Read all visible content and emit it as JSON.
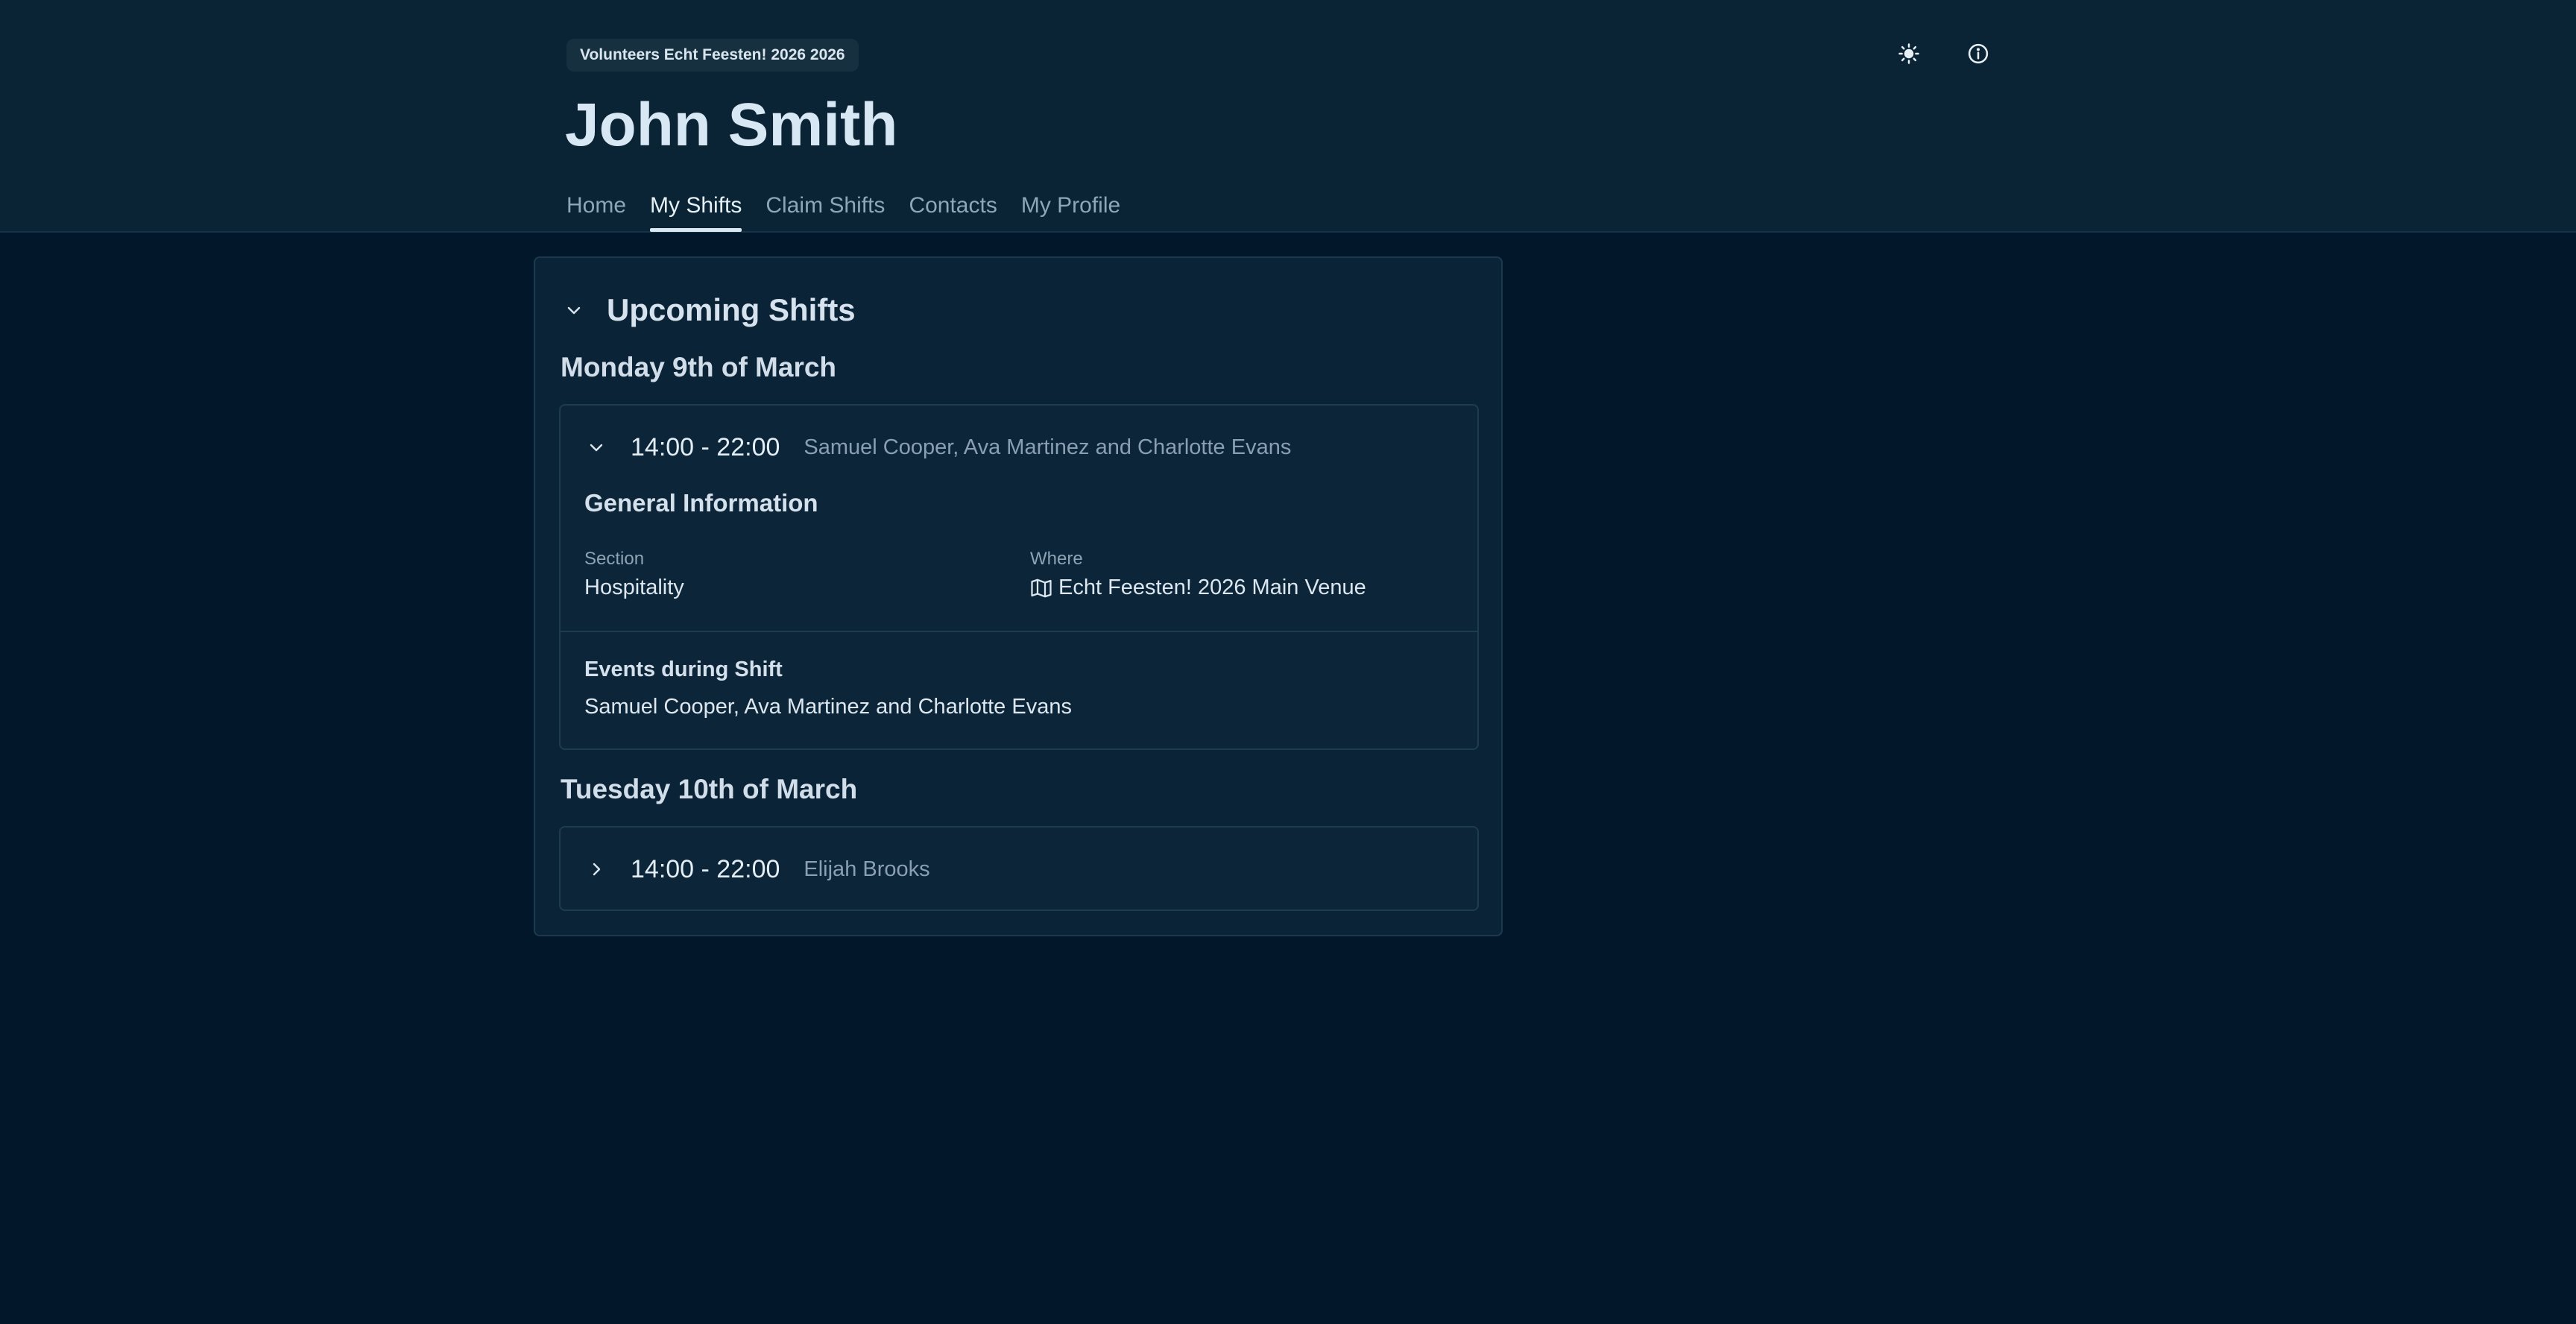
{
  "header": {
    "badge": "Volunteers Echt Feesten! 2026 2026",
    "title": "John Smith",
    "icons": [
      "sun-icon",
      "info-icon"
    ]
  },
  "nav": {
    "items": [
      "Home",
      "My Shifts",
      "Claim Shifts",
      "Contacts",
      "My Profile"
    ],
    "active": "My Shifts"
  },
  "upcoming": {
    "title": "Upcoming Shifts",
    "days": [
      {
        "heading": "Monday 9th of March",
        "shift": {
          "time": "14:00 - 22:00",
          "people": "Samuel Cooper, Ava Martinez and Charlotte Evans",
          "expanded": true,
          "general_title": "General Information",
          "section_label": "Section",
          "section_value": "Hospitality",
          "where_label": "Where",
          "where_value": "Echt Feesten! 2026 Main Venue",
          "events_title": "Events during Shift",
          "events_value": "Samuel Cooper, Ava Martinez and Charlotte Evans"
        }
      },
      {
        "heading": "Tuesday 10th of March",
        "shift": {
          "time": "14:00 - 22:00",
          "people": "Elijah Brooks",
          "expanded": false
        }
      }
    ]
  },
  "colors": {
    "background": "#03172b",
    "header": "#0a2335",
    "card": "#0b2336",
    "border": "#1c3a4d",
    "text": "#d6e2ee",
    "muted": "#8aa0b2"
  }
}
